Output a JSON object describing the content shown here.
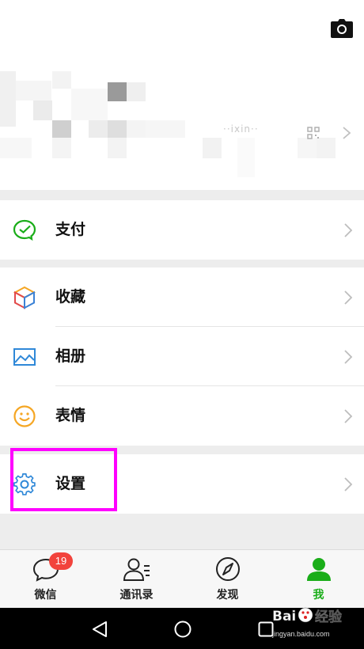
{
  "profile": {
    "wechat_id_fragment": "··ixin··",
    "camera_icon": "camera-icon",
    "qr_icon": "qr-code-icon"
  },
  "menu": {
    "pay": {
      "label": "支付",
      "icon": "wallet-icon"
    },
    "favorites": {
      "label": "收藏",
      "icon": "cube-icon"
    },
    "album": {
      "label": "相册",
      "icon": "picture-icon"
    },
    "stickers": {
      "label": "表情",
      "icon": "smiley-icon"
    },
    "settings": {
      "label": "设置",
      "icon": "gear-icon"
    }
  },
  "tabbar": {
    "tabs": [
      {
        "label": "微信",
        "icon": "chat-bubble-icon",
        "badge": "19"
      },
      {
        "label": "通讯录",
        "icon": "contacts-icon"
      },
      {
        "label": "发现",
        "icon": "compass-icon"
      },
      {
        "label": "我",
        "icon": "person-icon",
        "active": true
      }
    ]
  },
  "colors": {
    "accent": "#1aad19",
    "badge": "#f2433c",
    "highlight": "#ff00ff",
    "background": "#ededed"
  },
  "watermark": {
    "text": "jingyan.baidu.com",
    "brand": "Bai 经验"
  }
}
